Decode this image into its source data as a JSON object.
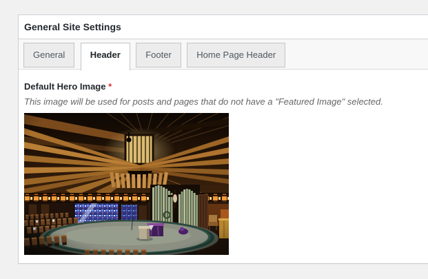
{
  "card": {
    "title": "General Site Settings",
    "tabs": [
      {
        "label": "General",
        "active": false
      },
      {
        "label": "Header",
        "active": true
      },
      {
        "label": "Footer",
        "active": false
      },
      {
        "label": "Home Page Header",
        "active": false
      }
    ],
    "field": {
      "label": "Default Hero Image",
      "required_marker": "*",
      "description": "This image will be used for posts and pages that do not have a \"Featured Image\" selected.",
      "image_alt": "Default hero image preview: church interior with radial wooden ceiling beams, stained glass windows, organ pipes and circular altar platform"
    },
    "colors": {
      "page_background": "#f1f1f1",
      "card_border": "#ccd0d4",
      "tab_bar_background": "#f8f8f8",
      "inactive_tab_background": "#ececec",
      "required_red": "#dc3232",
      "heading_text": "#23282d",
      "description_text": "#666666"
    }
  }
}
